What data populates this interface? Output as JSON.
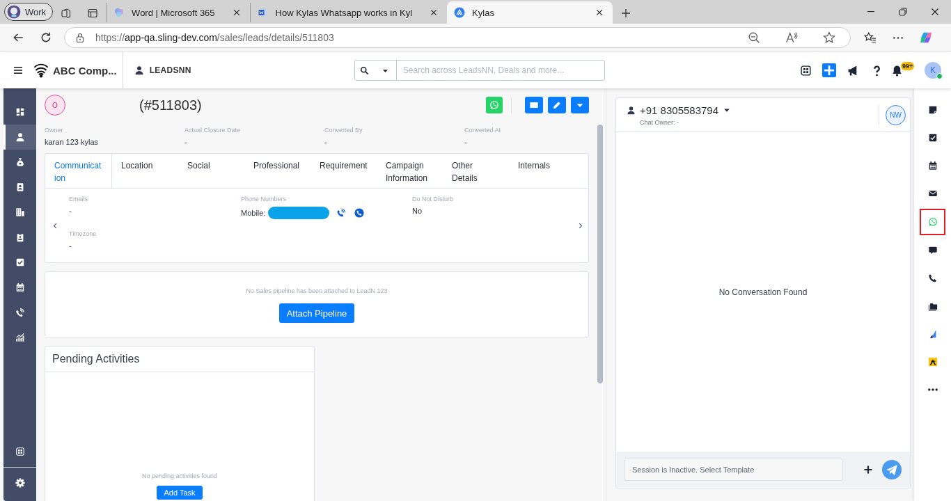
{
  "browser": {
    "profile": "Work",
    "tabs": [
      {
        "kind": "word",
        "title": "Word | Microsoft 365",
        "selected": false
      },
      {
        "kind": "doc",
        "title": "How Kylas Whatsapp works in Kyl",
        "selected": false
      },
      {
        "kind": "kylas",
        "title": "Kylas",
        "selected": true
      }
    ],
    "url": {
      "scheme": "https://",
      "host": "app-qa.sling-dev.com",
      "path": "/sales/leads/details/511803"
    }
  },
  "header": {
    "company": "ABC Comp...",
    "module": "LEADSNN",
    "search": {
      "placeholder": "Search across LeadsNN, Deals and more..."
    },
    "notification_badge": "99+",
    "avatar": "K"
  },
  "left_nav": [
    {
      "kind": "dashboard",
      "selected": false
    },
    {
      "kind": "user",
      "selected": true
    },
    {
      "kind": "moneybag",
      "selected": false
    },
    {
      "kind": "contact",
      "selected": false
    },
    {
      "kind": "building",
      "selected": false
    },
    {
      "kind": "clipboard",
      "selected": false
    },
    {
      "kind": "checkbox",
      "selected": false
    },
    {
      "kind": "calendar",
      "selected": false
    },
    {
      "kind": "signal",
      "selected": false
    },
    {
      "kind": "chart",
      "selected": false
    }
  ],
  "left_nav_bottom": [
    {
      "kind": "apps",
      "selected": false
    },
    {
      "kind": "gear",
      "selected": false
    }
  ],
  "lead": {
    "avatar": "O",
    "record_id": "(#511803)",
    "fields": [
      {
        "label": "Owner",
        "value": "karan 123 kylas"
      },
      {
        "label": "Actual Closure Date",
        "value": "-"
      },
      {
        "label": "Converted By",
        "value": "-"
      },
      {
        "label": "Converted At",
        "value": "-"
      }
    ]
  },
  "detail_tabs": [
    {
      "label": "Communication",
      "selected": true
    },
    {
      "label": "Location",
      "selected": false
    },
    {
      "label": "Social",
      "selected": false
    },
    {
      "label": "Professional",
      "selected": false
    },
    {
      "label": "Requirement",
      "selected": false
    },
    {
      "label": "Campaign Information",
      "selected": false
    },
    {
      "label": "Other Details",
      "selected": false
    },
    {
      "label": "Internals",
      "selected": false
    }
  ],
  "communication": {
    "emails": {
      "label": "Emails",
      "value": "-"
    },
    "phone_numbers": {
      "label": "Phone Numbers",
      "mobile_label": "Mobile:"
    },
    "do_not_disturb": {
      "label": "Do Not Disturb",
      "value": "No"
    },
    "timezone": {
      "label": "Timezone",
      "value": "-"
    }
  },
  "pipeline": {
    "message": "No Sales pipeline has been attached to LeadN 123",
    "button": "Attach Pipeline"
  },
  "pending_activities": {
    "title": "Pending Activities",
    "empty_message": "No pending activities found",
    "button": "Add Task"
  },
  "chat": {
    "phone": "+91 8305583794",
    "chat_owner": "Chat Owner: -",
    "avatar": "NW",
    "empty_message": "No Conversation Found",
    "input": {
      "placeholder": "Session is Inactive. Select Template"
    }
  },
  "right_rail": [
    {
      "kind": "note",
      "selected": false
    },
    {
      "kind": "task",
      "selected": false
    },
    {
      "kind": "calendar",
      "selected": false
    },
    {
      "kind": "email",
      "selected": false
    },
    {
      "kind": "whatsapp",
      "selected": true
    },
    {
      "kind": "chat",
      "selected": false
    },
    {
      "kind": "phone",
      "selected": false
    },
    {
      "kind": "folder",
      "selected": false
    },
    {
      "kind": "sail",
      "selected": false
    },
    {
      "kind": "logo",
      "selected": false
    },
    {
      "kind": "more",
      "selected": false
    }
  ]
}
